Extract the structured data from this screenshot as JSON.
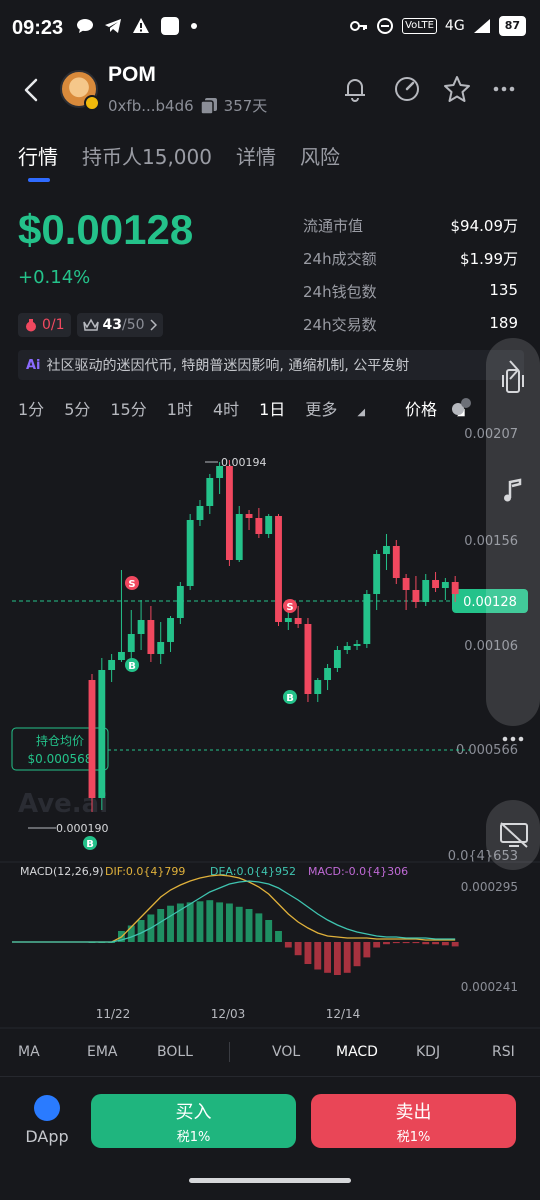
{
  "status_bar": {
    "time": "09:23",
    "network": "4G",
    "volte": "VoLTE",
    "battery": "87"
  },
  "header": {
    "token": "POM",
    "address": "0xfb...b4d6",
    "age": "357天"
  },
  "tabs": [
    {
      "label": "行情",
      "active": true
    },
    {
      "label": "持币人15,000",
      "active": false
    },
    {
      "label": "详情",
      "active": false
    },
    {
      "label": "风险",
      "active": false
    }
  ],
  "price": {
    "value": "$0.00128",
    "change": "+0.14%"
  },
  "chips": {
    "bag": "0/1",
    "crown_value": "43",
    "crown_total": "/50"
  },
  "stats": [
    {
      "label": "流通市值",
      "value": "$94.09万"
    },
    {
      "label": "24h成交额",
      "value": "$1.99万"
    },
    {
      "label": "24h钱包数",
      "value": "135"
    },
    {
      "label": "24h交易数",
      "value": "189"
    }
  ],
  "description": {
    "tag": "Ai",
    "text": "社区驱动的迷因代币, 特朗普迷因影响, 通缩机制, 公平发射"
  },
  "intervals": {
    "items": [
      "1分",
      "5分",
      "15分",
      "1时",
      "4时",
      "1日",
      "更多"
    ],
    "active": "1日",
    "price_toggle": "价格"
  },
  "chart_axis": {
    "y_labels": [
      "0.00207",
      "0.00156",
      "0.00106",
      "0.000566",
      "0.0{4}653"
    ],
    "current_price": "0.00128",
    "high_label": "0.00194",
    "low_label": "0.000190",
    "avg_title": "持仓均价",
    "avg_value": "$0.000568",
    "watermark": "Ave.ai",
    "macd_title": "MACD(12,26,9)",
    "dif": "DIF:0.0{4}799",
    "dea": "DEA:0.0{4}952",
    "macd": "MACD:-0.0{4}306",
    "macd_y": [
      "0.000295",
      "0.000241"
    ],
    "x_labels": [
      "11/22",
      "12/03",
      "12/14"
    ],
    "markers": {
      "buy": "B",
      "sell": "S"
    }
  },
  "chart_data": {
    "type": "candlestick",
    "x_labels": [
      "11/22",
      "12/03",
      "12/14"
    ],
    "candles": [
      {
        "o": 0.00085,
        "h": 0.00088,
        "l": 0.00019,
        "c": 0.00026
      },
      {
        "o": 0.00026,
        "h": 0.00096,
        "l": 0.0002,
        "c": 0.0009
      },
      {
        "o": 0.0009,
        "h": 0.00098,
        "l": 0.00084,
        "c": 0.00095
      },
      {
        "o": 0.00095,
        "h": 0.0014,
        "l": 0.00094,
        "c": 0.00099
      },
      {
        "o": 0.00099,
        "h": 0.0012,
        "l": 0.00095,
        "c": 0.00108
      },
      {
        "o": 0.00108,
        "h": 0.00125,
        "l": 0.001,
        "c": 0.00115
      },
      {
        "o": 0.00115,
        "h": 0.00122,
        "l": 0.00094,
        "c": 0.00098
      },
      {
        "o": 0.00098,
        "h": 0.00114,
        "l": 0.00093,
        "c": 0.00104
      },
      {
        "o": 0.00104,
        "h": 0.00117,
        "l": 0.00099,
        "c": 0.00116
      },
      {
        "o": 0.00116,
        "h": 0.00134,
        "l": 0.00113,
        "c": 0.00132
      },
      {
        "o": 0.00132,
        "h": 0.00168,
        "l": 0.0013,
        "c": 0.00165
      },
      {
        "o": 0.00165,
        "h": 0.00175,
        "l": 0.00162,
        "c": 0.00172
      },
      {
        "o": 0.00172,
        "h": 0.00188,
        "l": 0.00168,
        "c": 0.00186
      },
      {
        "o": 0.00186,
        "h": 0.00194,
        "l": 0.00178,
        "c": 0.00192
      },
      {
        "o": 0.00192,
        "h": 0.00195,
        "l": 0.00142,
        "c": 0.00145
      },
      {
        "o": 0.00145,
        "h": 0.00172,
        "l": 0.00144,
        "c": 0.00168
      },
      {
        "o": 0.00168,
        "h": 0.0017,
        "l": 0.0016,
        "c": 0.00166
      },
      {
        "o": 0.00166,
        "h": 0.00171,
        "l": 0.00156,
        "c": 0.00158
      },
      {
        "o": 0.00158,
        "h": 0.00168,
        "l": 0.00156,
        "c": 0.00167
      },
      {
        "o": 0.00167,
        "h": 0.00168,
        "l": 0.00112,
        "c": 0.00114
      },
      {
        "o": 0.00114,
        "h": 0.00119,
        "l": 0.0011,
        "c": 0.00116
      },
      {
        "o": 0.00116,
        "h": 0.00122,
        "l": 0.00111,
        "c": 0.00113
      },
      {
        "o": 0.00113,
        "h": 0.00116,
        "l": 0.00074,
        "c": 0.00078
      },
      {
        "o": 0.00078,
        "h": 0.00086,
        "l": 0.00074,
        "c": 0.00085
      },
      {
        "o": 0.00085,
        "h": 0.00093,
        "l": 0.0008,
        "c": 0.00091
      },
      {
        "o": 0.00091,
        "h": 0.00102,
        "l": 0.00089,
        "c": 0.001
      },
      {
        "o": 0.001,
        "h": 0.00104,
        "l": 0.00098,
        "c": 0.00102
      },
      {
        "o": 0.00102,
        "h": 0.00105,
        "l": 0.001,
        "c": 0.00103
      },
      {
        "o": 0.00103,
        "h": 0.0013,
        "l": 0.00101,
        "c": 0.00128
      },
      {
        "o": 0.00128,
        "h": 0.0015,
        "l": 0.0012,
        "c": 0.00148
      },
      {
        "o": 0.00148,
        "h": 0.00158,
        "l": 0.0014,
        "c": 0.00152
      },
      {
        "o": 0.00152,
        "h": 0.00155,
        "l": 0.00133,
        "c": 0.00136
      },
      {
        "o": 0.00136,
        "h": 0.00138,
        "l": 0.0012,
        "c": 0.0013
      },
      {
        "o": 0.0013,
        "h": 0.00137,
        "l": 0.00121,
        "c": 0.00124
      },
      {
        "o": 0.00124,
        "h": 0.00138,
        "l": 0.00122,
        "c": 0.00135
      },
      {
        "o": 0.00135,
        "h": 0.00139,
        "l": 0.00129,
        "c": 0.00131
      },
      {
        "o": 0.00131,
        "h": 0.00136,
        "l": 0.00125,
        "c": 0.00134
      },
      {
        "o": 0.00134,
        "h": 0.00137,
        "l": 0.00124,
        "c": 0.00128
      }
    ],
    "current_price": 0.00128,
    "avg_cost": 0.000568,
    "y_ticks": [
      0.00207,
      0.00156,
      0.00106,
      0.000566
    ],
    "macd_hist": [
      0,
      0,
      0,
      0.1,
      0.15,
      0.2,
      0.25,
      0.3,
      0.33,
      0.35,
      0.36,
      0.37,
      0.38,
      0.36,
      0.35,
      0.32,
      0.3,
      0.26,
      0.2,
      0.1,
      -0.05,
      -0.12,
      -0.2,
      -0.25,
      -0.28,
      -0.3,
      -0.28,
      -0.22,
      -0.14,
      -0.05,
      -0.02,
      -0.01,
      -0.01,
      -0.01,
      -0.02,
      -0.02,
      -0.03,
      -0.04
    ],
    "dif": [
      0,
      0,
      0,
      0.05,
      0.15,
      0.25,
      0.35,
      0.45,
      0.52,
      0.57,
      0.61,
      0.64,
      0.66,
      0.67,
      0.66,
      0.64,
      0.6,
      0.55,
      0.48,
      0.38,
      0.28,
      0.2,
      0.14,
      0.09,
      0.06,
      0.05,
      0.04,
      0.04,
      0.04,
      0.03,
      0.03,
      0.03,
      0.03,
      0.03,
      0.02,
      0.02,
      0.02,
      0.02
    ],
    "dea": [
      0,
      0,
      0,
      0.02,
      0.05,
      0.09,
      0.14,
      0.2,
      0.26,
      0.32,
      0.38,
      0.44,
      0.5,
      0.54,
      0.58,
      0.6,
      0.61,
      0.6,
      0.58,
      0.54,
      0.48,
      0.42,
      0.35,
      0.28,
      0.22,
      0.17,
      0.13,
      0.1,
      0.08,
      0.06,
      0.05,
      0.05,
      0.04,
      0.04,
      0.04,
      0.03,
      0.03,
      0.03
    ]
  },
  "indicator_tabs": [
    "MA",
    "EMA",
    "BOLL",
    "VOL",
    "MACD",
    "KDJ",
    "RSI"
  ],
  "indicator_active": "MACD",
  "footer": {
    "dapp": "DApp",
    "buy": "买入",
    "buy_tax": "税1%",
    "sell": "卖出",
    "sell_tax": "税1%"
  },
  "colors": {
    "up": "#24c28a",
    "down": "#f0485f",
    "accent": "#2f6bff",
    "bg": "#17181c"
  }
}
